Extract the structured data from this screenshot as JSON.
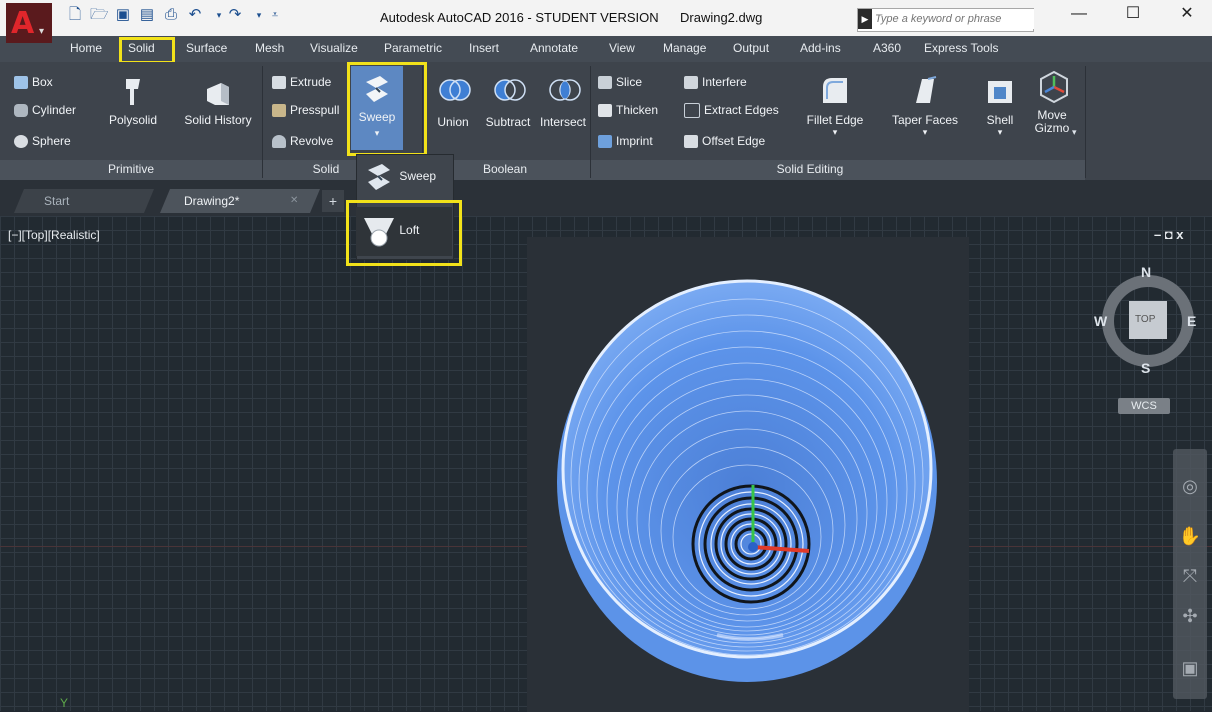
{
  "title": {
    "app": "Autodesk AutoCAD 2016 - STUDENT VERSION",
    "file": "Drawing2.dwg"
  },
  "search": {
    "placeholder": "Type a keyword or phrase"
  },
  "window_controls": {
    "minimize": "—",
    "maximize": "☐",
    "close": "✕"
  },
  "ribbon_tabs": [
    "Home",
    "Solid",
    "Surface",
    "Mesh",
    "Visualize",
    "Parametric",
    "Insert",
    "Annotate",
    "View",
    "Manage",
    "Output",
    "Add-ins",
    "A360",
    "Express Tools"
  ],
  "active_tab": "Solid",
  "primitive": {
    "box": "Box",
    "cylinder": "Cylinder",
    "sphere": "Sphere",
    "polysolid": "Polysolid",
    "solid_history": "Solid History",
    "label": "Primitive"
  },
  "solid": {
    "extrude": "Extrude",
    "presspull": "Presspull",
    "revolve": "Revolve",
    "sweep": "Sweep",
    "label": "Solid"
  },
  "boolean": {
    "union": "Union",
    "subtract": "Subtract",
    "intersect": "Intersect",
    "label": "Boolean"
  },
  "solid_editing": {
    "slice": "Slice",
    "thicken": "Thicken",
    "imprint": "Imprint",
    "interfere": "Interfere",
    "extract_edges": "Extract Edges",
    "offset_edge": "Offset Edge",
    "fillet_edge": "Fillet Edge",
    "taper_faces": "Taper Faces",
    "shell": "Shell",
    "move": "Move",
    "gizmo": "Gizmo",
    "label": "Solid Editing"
  },
  "flyout": {
    "sweep": "Sweep",
    "loft": "Loft"
  },
  "doc_tabs": {
    "start": "Start",
    "drawing": "Drawing2*",
    "close": "✕",
    "new": "+"
  },
  "viewport": {
    "label": "[−][Top][Realistic]",
    "controls": "– ◘ x"
  },
  "viewcube": {
    "n": "N",
    "s": "S",
    "e": "E",
    "w": "W",
    "top": "TOP",
    "wcs": "WCS"
  },
  "colors": {
    "highlight": "#f2e21a",
    "bowl": "#5e95ea",
    "ribbon": "#3e444c"
  }
}
